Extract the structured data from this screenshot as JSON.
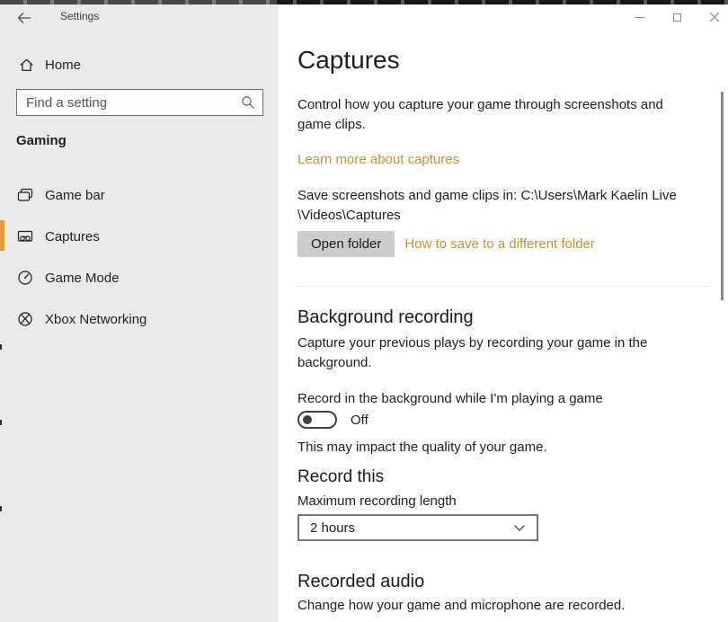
{
  "titlebar": {
    "title": "Settings",
    "window_controls": {
      "minimize": "minimize",
      "maximize": "maximize",
      "close": "close"
    }
  },
  "sidebar": {
    "home_label": "Home",
    "search_placeholder": "Find a setting",
    "section_title": "Gaming",
    "items": [
      {
        "label": "Game bar",
        "icon": "game-bar-icon",
        "selected": false
      },
      {
        "label": "Captures",
        "icon": "captures-icon",
        "selected": true
      },
      {
        "label": "Game Mode",
        "icon": "game-mode-icon",
        "selected": false
      },
      {
        "label": "Xbox Networking",
        "icon": "xbox-logo-icon",
        "selected": false
      }
    ]
  },
  "main": {
    "title": "Captures",
    "intro": "Control how you capture your game through screenshots and game clips.",
    "learn_more_link": "Learn more about captures",
    "save_path_line1": "Save screenshots and game clips in: C:\\Users\\Mark Kaelin Live",
    "save_path_line2": "\\Videos\\Captures",
    "open_folder_button": "Open folder",
    "different_folder_link": "How to save to a different folder",
    "background_recording": {
      "heading": "Background recording",
      "description": "Capture your previous plays by recording your game in the background.",
      "toggle_label": "Record in the background while I'm playing a game",
      "toggle_state": "Off",
      "note": "This may impact the quality of your game."
    },
    "record_this": {
      "heading": "Record this",
      "label": "Maximum recording length",
      "selected_option": "2 hours"
    },
    "recorded_audio": {
      "heading": "Recorded audio",
      "description": "Change how your game and microphone are recorded."
    }
  },
  "icons": {
    "back": "arrow-left-icon",
    "home": "home-icon",
    "search": "magnifier-icon",
    "nav": [
      "game-bar-icon",
      "captures-icon",
      "game-mode-icon",
      "xbox-logo-icon"
    ],
    "select": "chevron-down-icon",
    "window": [
      "minimize-icon",
      "maximize-icon",
      "close-icon"
    ]
  },
  "colors": {
    "accent_bar": "#dda03a",
    "link": "#c5923a",
    "sidebar_bg": "#eaeaea",
    "button_bg": "#cccccc"
  }
}
